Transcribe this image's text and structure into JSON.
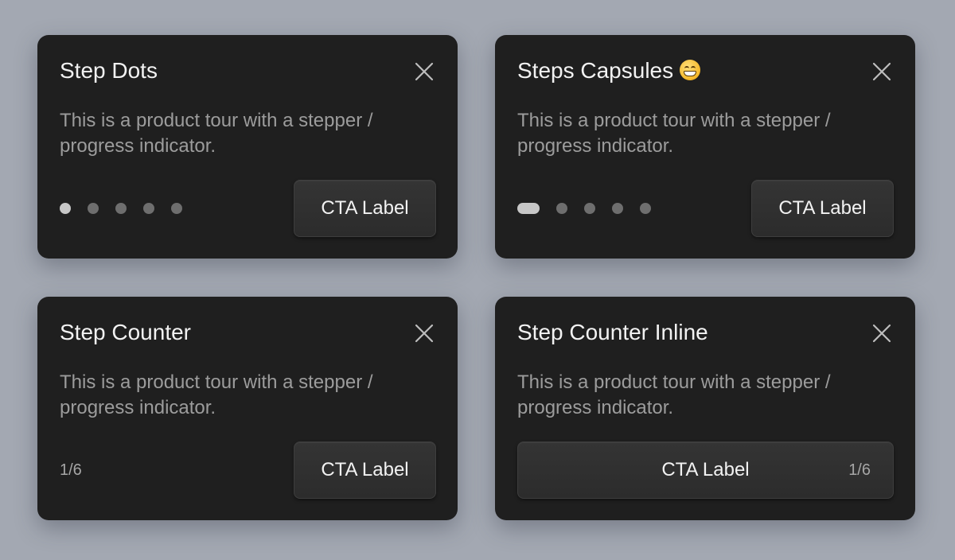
{
  "cards": [
    {
      "title": "Step Dots",
      "description": "This is a product tour with a stepper / progress indicator.",
      "cta_label": "CTA Label",
      "indicator": "dots",
      "total_steps": 5,
      "current_step": 1
    },
    {
      "title": "Steps Capsules",
      "title_emoji": "grinning-face-emoji",
      "description": "This is a product tour with a stepper / progress indicator.",
      "cta_label": "CTA Label",
      "indicator": "capsules",
      "total_steps": 5,
      "current_step": 1
    },
    {
      "title": "Step Counter",
      "description": "This is a product tour with a stepper / progress indicator.",
      "cta_label": "CTA Label",
      "indicator": "counter",
      "counter": "1/6"
    },
    {
      "title": "Step Counter Inline",
      "description": "This is a product tour with a stepper / progress indicator.",
      "cta_label": "CTA Label",
      "indicator": "counter-inline",
      "counter": "1/6"
    }
  ],
  "icons": {
    "close": "close-icon"
  },
  "colors": {
    "page_background": "#a3a8b2",
    "card_background": "#1f1f1f",
    "button_background": "#303030",
    "title_text": "#f2f2f2",
    "body_text": "#9c9c9c",
    "active_dot": "#c7c7c7",
    "inactive_dot": "#6e6e6e"
  }
}
